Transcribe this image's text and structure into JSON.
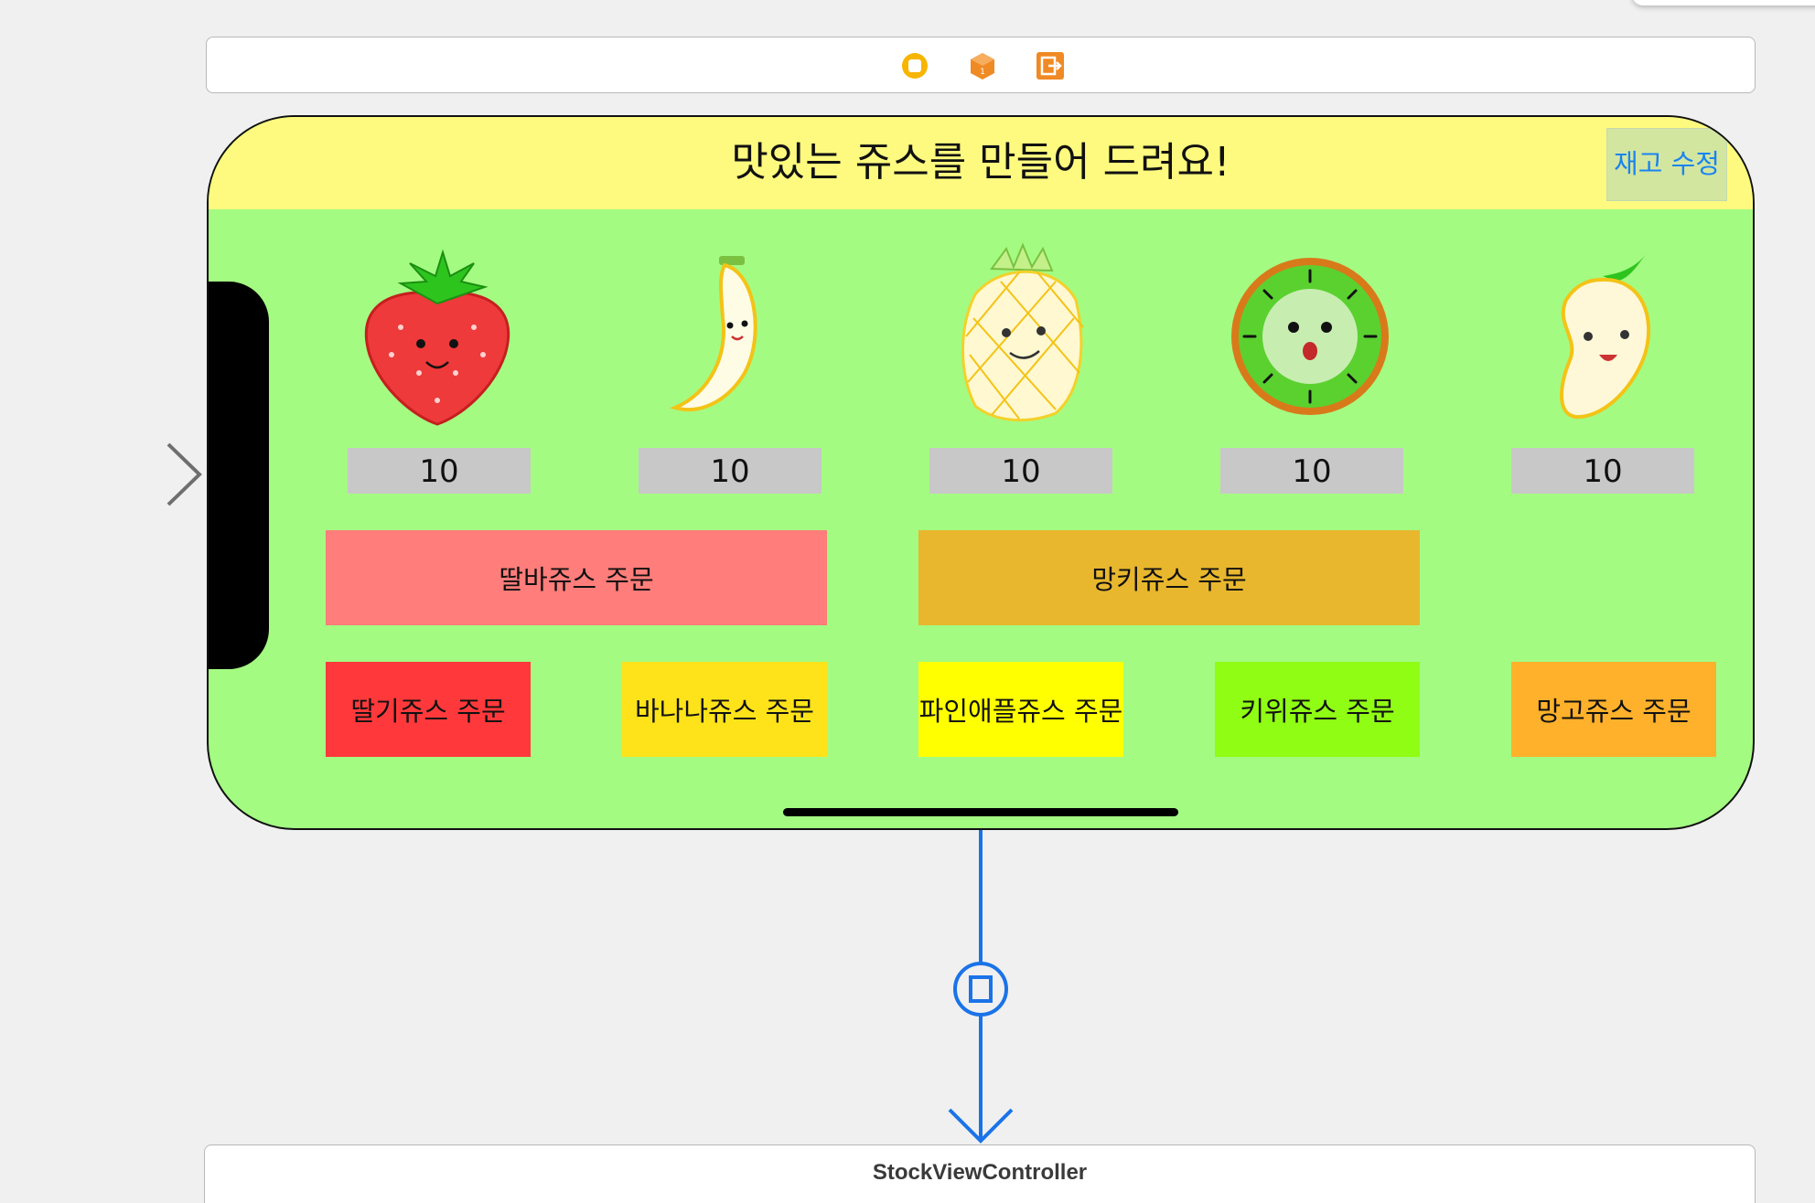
{
  "scene": {
    "title": "맛있는 쥬스를 만들어 드려요!",
    "edit_stock_button": "재고 수정"
  },
  "dock": {
    "icons": [
      "view-controller-icon",
      "first-responder-icon",
      "exit-icon"
    ]
  },
  "fruits": [
    {
      "name": "strawberry",
      "stock": "10"
    },
    {
      "name": "banana",
      "stock": "10"
    },
    {
      "name": "pineapple",
      "stock": "10"
    },
    {
      "name": "kiwi",
      "stock": "10"
    },
    {
      "name": "mango",
      "stock": "10"
    }
  ],
  "buttons": {
    "strawberry_banana": {
      "label": "딸바쥬스 주문",
      "color": "#ff7d7a"
    },
    "mango_kiwi": {
      "label": "망키쥬스 주문",
      "color": "#e8b72e"
    },
    "strawberry": {
      "label": "딸기쥬스 주문",
      "color": "#ff393b"
    },
    "banana": {
      "label": "바나나쥬스 주문",
      "color": "#ffe31a"
    },
    "pineapple": {
      "label": "파인애플쥬스 주문",
      "color": "#ffff00"
    },
    "kiwi": {
      "label": "키위쥬스 주문",
      "color": "#8ffd14"
    },
    "mango": {
      "label": "망고쥬스 주문",
      "color": "#ffb12b"
    }
  },
  "segue": {
    "kind": "present-modally-icon",
    "color": "#1a73e8"
  },
  "destination": {
    "title": "StockViewController"
  },
  "colors": {
    "canvas": "#f0f0f0",
    "navbar": "#fefa7f",
    "view_background": "#a4fb82",
    "stock_label_bg": "#c8c8c8"
  }
}
